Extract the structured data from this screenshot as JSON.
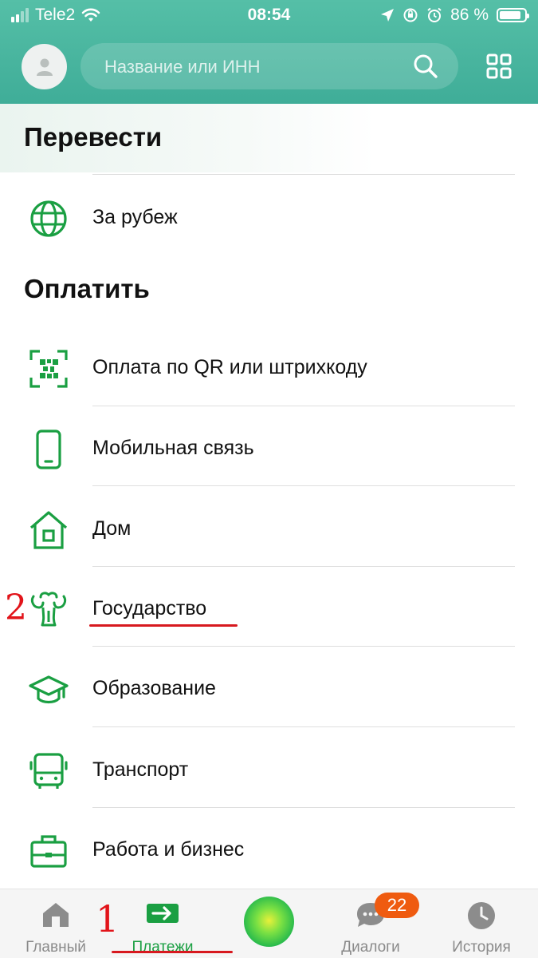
{
  "status_bar": {
    "carrier": "Tele2",
    "time": "08:54",
    "battery": "86 %",
    "battery_level": 0.86
  },
  "header": {
    "search_placeholder": "Название или ИНН"
  },
  "sections": {
    "transfer": {
      "title": "Перевести",
      "items": [
        {
          "label": "За рубеж",
          "icon": "globe-icon"
        }
      ]
    },
    "pay": {
      "title": "Оплатить",
      "items": [
        {
          "label": "Оплата по QR или штрихкоду",
          "icon": "qr-scan-icon"
        },
        {
          "label": "Мобильная связь",
          "icon": "mobile-phone-icon"
        },
        {
          "label": "Дом",
          "icon": "house-icon"
        },
        {
          "label": "Государство",
          "icon": "state-emblem-icon"
        },
        {
          "label": "Образование",
          "icon": "graduation-cap-icon"
        },
        {
          "label": "Транспорт",
          "icon": "bus-icon"
        },
        {
          "label": "Работа и бизнес",
          "icon": "briefcase-icon"
        }
      ]
    }
  },
  "annotations": {
    "marker_1": "1",
    "marker_2": "2",
    "color": "#e2141a"
  },
  "tabbar": {
    "items": [
      {
        "label": "Главный",
        "icon": "home-icon",
        "active": false
      },
      {
        "label": "Платежи",
        "icon": "payments-arrow-icon",
        "active": true
      },
      {
        "label": "",
        "icon": "assistant-orb-icon",
        "active": false
      },
      {
        "label": "Диалоги",
        "icon": "chat-bubble-icon",
        "active": false,
        "badge": "22"
      },
      {
        "label": "История",
        "icon": "clock-icon",
        "active": false
      }
    ]
  },
  "colors": {
    "header": "#46b39e",
    "accent_green": "#1a9f42",
    "badge": "#ef5b10"
  }
}
